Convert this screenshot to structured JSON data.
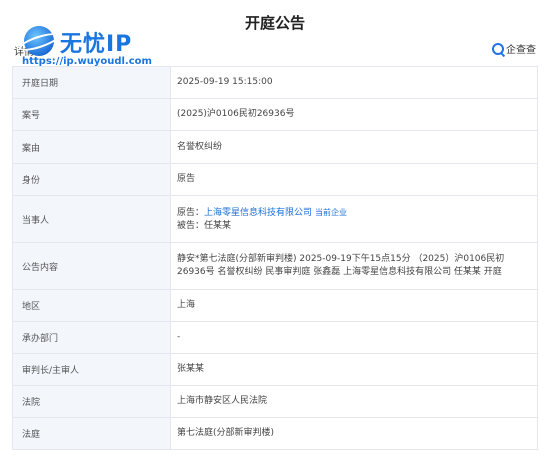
{
  "page": {
    "title": "开庭公告"
  },
  "watermark": {
    "name": "无忧IP",
    "url": "https://ip.wuyoudl.com"
  },
  "section": {
    "label": "详情"
  },
  "brand": {
    "label": "企查查"
  },
  "rows": [
    {
      "label": "开庭日期",
      "value": "2025-09-19 15:15:00"
    },
    {
      "label": "案号",
      "value": "(2025)沪0106民初26936号"
    },
    {
      "label": "案由",
      "value": "名誉权纠纷"
    },
    {
      "label": "身份",
      "value": "原告"
    },
    {
      "label": "当事人",
      "plaintiff_prefix": "原告：",
      "plaintiff_name": "上海零星信息科技有限公司",
      "plaintiff_tag": "当前企业",
      "defendant": "被告：任某某"
    },
    {
      "label": "公告内容",
      "value": "静安*第七法庭(分部新审判楼) 2025-09-19下午15点15分 （2025）沪0106民初26936号 名誉权纠纷 民事审判庭 张鑫磊 上海零星信息科技有限公司 任某某 开庭"
    },
    {
      "label": "地区",
      "value": "上海"
    },
    {
      "label": "承办部门",
      "value": "-"
    },
    {
      "label": "审判长/主审人",
      "value": "张某某"
    },
    {
      "label": "法院",
      "value": "上海市静安区人民法院"
    },
    {
      "label": "法庭",
      "value": "第七法庭(分部新审判楼)"
    }
  ]
}
